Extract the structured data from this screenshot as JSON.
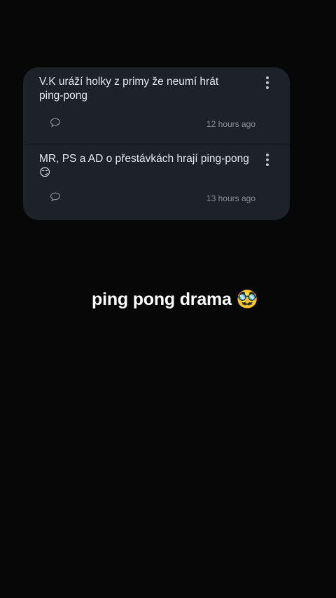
{
  "posts": [
    {
      "text": "V.K uráží holky z primy že neumí hrát\nping-pong",
      "time": "12 hours ago",
      "comment_icon": "speech-bubble-icon",
      "menu_icon": "more-vertical-icon"
    },
    {
      "text": "MR, PS a AD o přestávkách hrají ping-pong\n😏",
      "time": "13 hours ago",
      "comment_icon": "speech-bubble-icon",
      "menu_icon": "more-vertical-icon"
    }
  ],
  "caption": {
    "text": "ping pong drama 🥸"
  },
  "colors": {
    "background": "#070707",
    "card": "#1d2128",
    "text": "#e6e8ec",
    "muted": "#8b9098"
  }
}
